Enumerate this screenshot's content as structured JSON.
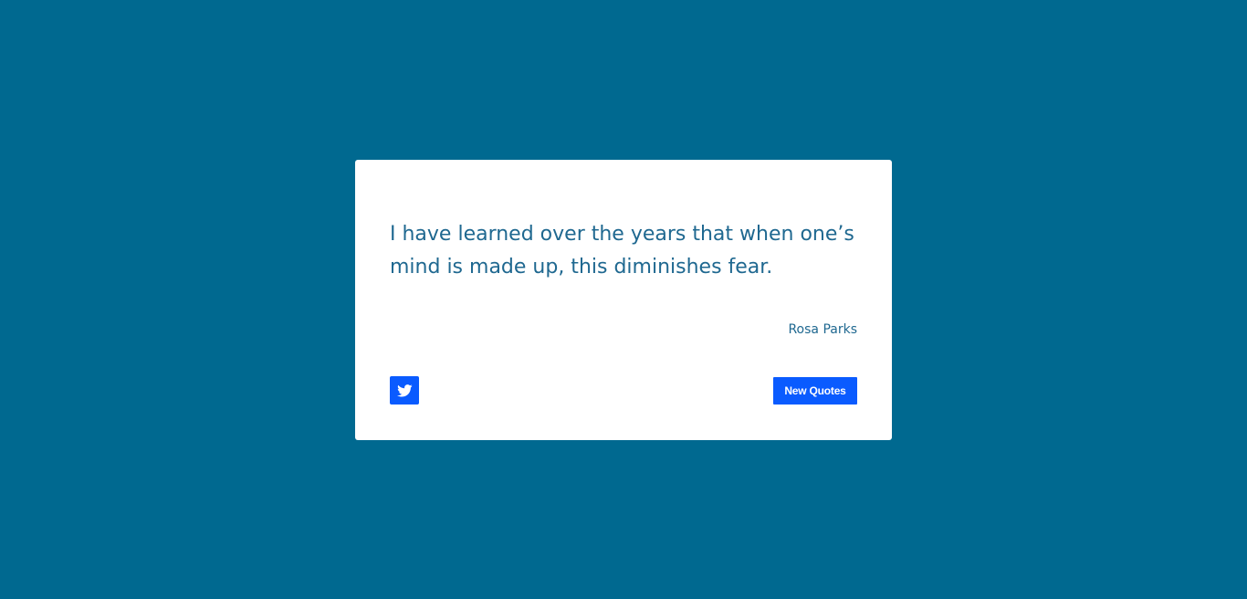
{
  "quote": {
    "text": "I have learned over the years that when one’s mind is made up, this diminishes fear.",
    "author": "Rosa Parks"
  },
  "actions": {
    "tweet_icon": "twitter-icon",
    "new_quote_label": "New Quotes"
  },
  "colors": {
    "background": "#006990",
    "card": "#ffffff",
    "text": "#1f6890",
    "accent": "#0a5bff"
  }
}
